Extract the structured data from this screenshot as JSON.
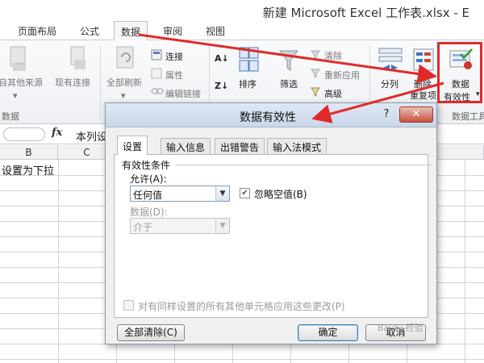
{
  "window": {
    "title": "新建 Microsoft Excel 工作表.xlsx - E"
  },
  "ribbon_tabs": [
    {
      "label": "页面布局"
    },
    {
      "label": "公式"
    },
    {
      "label": "数据"
    },
    {
      "label": "审阅"
    },
    {
      "label": "视图"
    }
  ],
  "ribbon": {
    "get_external": "自其他来源",
    "existing_conn": "现有连接",
    "group_external": "数据",
    "refresh_all": "全部刷新",
    "connections": "连接",
    "properties": "属性",
    "edit_links": "编辑链接",
    "sort": "排序",
    "filter": "筛选",
    "clear": "清除",
    "reapply": "重新应用",
    "advanced": "高级",
    "text_to_columns": "分列",
    "remove_dup_1": "删除",
    "remove_dup_2": "重复项",
    "data_validation_1": "数据",
    "data_validation_2": "有效性",
    "group_data_tools": "数据工具",
    "accent": "#e02a2a"
  },
  "formula_bar": {
    "fx": "fx",
    "content": "本列设"
  },
  "grid": {
    "columns": [
      "B",
      "C"
    ],
    "cell_b1": "设置为下拉"
  },
  "dialog": {
    "title": "数据有效性",
    "help": "?",
    "close": "✕",
    "tabs": [
      "设置",
      "输入信息",
      "出错警告",
      "输入法模式"
    ],
    "section": "有效性条件",
    "allow_label": "允许(A):",
    "allow_value": "任何值",
    "ignore_blank_label": "忽略空值(B)",
    "data_label": "数据(D):",
    "data_value": "介于",
    "apply_all_label": "对有同样设置的所有其他单元格应用这些更改(P)",
    "clear_all": "全部清除(C)",
    "ok": "确定",
    "cancel": "取消"
  },
  "watermark": "Baidu 经验"
}
